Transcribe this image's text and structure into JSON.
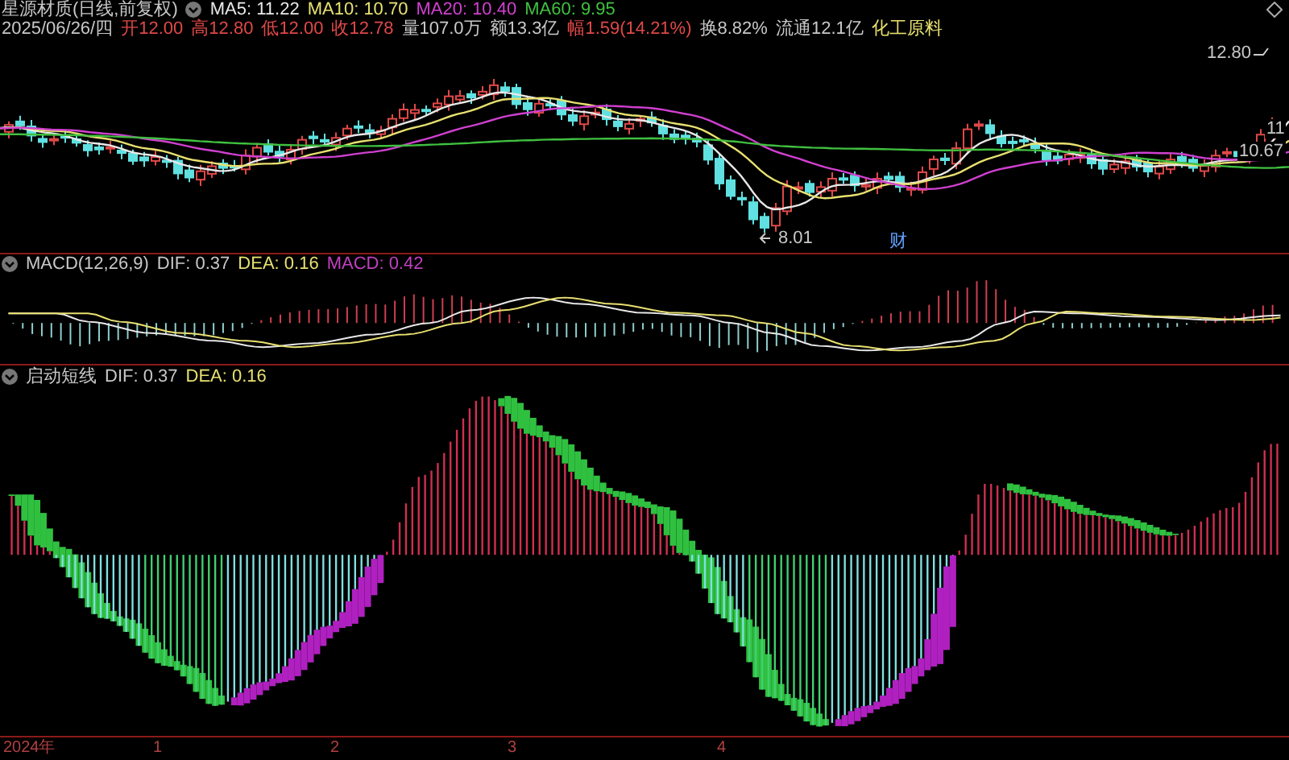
{
  "title": {
    "name": "星源材质(日线,前复权)",
    "averages": [
      {
        "label": "MA5: 11.22",
        "color": "#e8e8e8"
      },
      {
        "label": "MA10: 10.70",
        "color": "#e8e070"
      },
      {
        "label": "MA20: 10.40",
        "color": "#d040d0"
      },
      {
        "label": "MA60: 9.95",
        "color": "#40c040"
      }
    ]
  },
  "quote": {
    "date": "2025/06/26/四",
    "items": [
      {
        "label": "开",
        "value": "12.00",
        "color": "#e04848"
      },
      {
        "label": "高",
        "value": "12.80",
        "color": "#e04848"
      },
      {
        "label": "低",
        "value": "12.00",
        "color": "#e04848"
      },
      {
        "label": "收",
        "value": "12.78",
        "color": "#e04848"
      },
      {
        "label": "量",
        "value": "107.0万",
        "color": "#c8c8c8"
      },
      {
        "label": "额",
        "value": "13.3亿",
        "color": "#c8c8c8"
      },
      {
        "label": "幅",
        "value": "1.59(14.21%)",
        "color": "#e04848"
      },
      {
        "label": "换",
        "value": "8.82%",
        "color": "#c8c8c8"
      },
      {
        "label": "流通",
        "value": "12.1亿",
        "color": "#c8c8c8"
      },
      {
        "value": "化工原料",
        "color": "#e8e070"
      }
    ]
  },
  "price_labels": [
    "12.80",
    "11",
    "10.67",
    "8.01"
  ],
  "event_marker": "财",
  "macd": {
    "name": "MACD(12,26,9)",
    "dif": "DIF: 0.37",
    "dea": "DEA: 0.16",
    "macd": "MACD: 0.42"
  },
  "indicator": {
    "name": "启动短线",
    "dif": "DIF: 0.37",
    "dea": "DEA: 0.16"
  },
  "axis_labels": [
    "2024年",
    "1",
    "2",
    "3",
    "4"
  ]
}
